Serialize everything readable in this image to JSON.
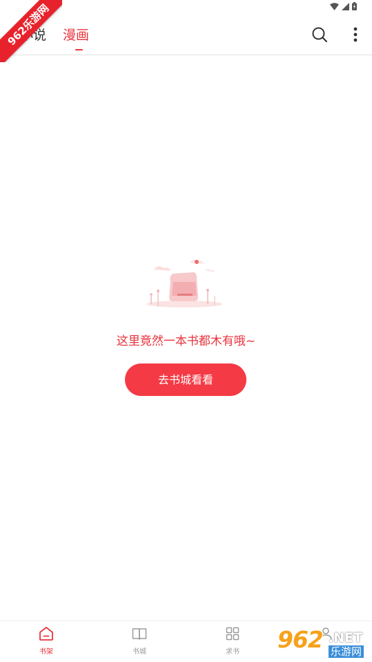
{
  "watermark": {
    "ribbon_text": "962乐游网",
    "corner_brand": "962",
    "corner_net": ".NET",
    "corner_sub": "乐游网"
  },
  "header": {
    "tabs": [
      {
        "label": "小说",
        "active": false
      },
      {
        "label": "漫画",
        "active": true
      }
    ],
    "search_icon": "search-icon",
    "more_icon": "more-vertical-icon"
  },
  "empty_state": {
    "message": "这里竟然一本书都木有哦~",
    "button_label": "去书城看看"
  },
  "bottom_nav": {
    "items": [
      {
        "label": "书架",
        "icon": "home-icon",
        "active": true
      },
      {
        "label": "书城",
        "icon": "book-icon",
        "active": false
      },
      {
        "label": "求书",
        "icon": "grid-icon",
        "active": false
      },
      {
        "label": "",
        "icon": "user-icon",
        "active": false
      }
    ]
  },
  "colors": {
    "accent": "#e8333c",
    "button": "#f43a45",
    "text_default": "#333333",
    "nav_inactive": "#9a9a9a"
  }
}
